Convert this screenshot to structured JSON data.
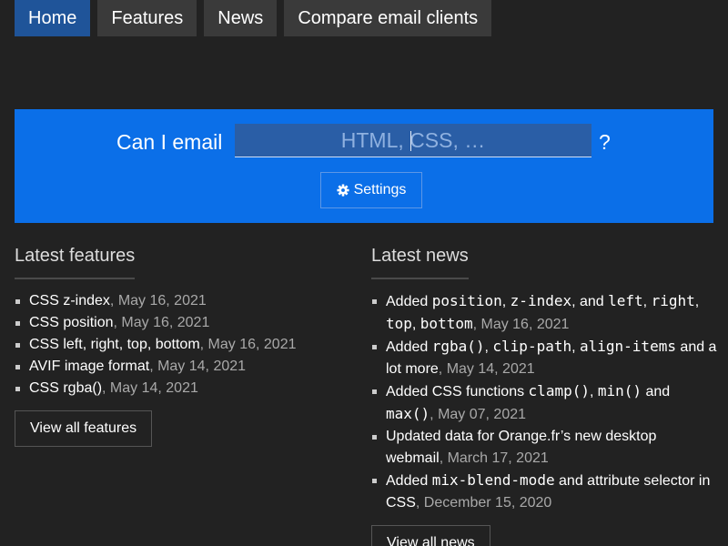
{
  "nav": {
    "items": [
      {
        "label": "Home",
        "active": true
      },
      {
        "label": "Features",
        "active": false
      },
      {
        "label": "News",
        "active": false
      },
      {
        "label": "Compare email clients",
        "active": false
      }
    ]
  },
  "hero": {
    "label": "Can I email",
    "search_placeholder": "HTML, CSS, …",
    "question_mark": "?",
    "settings_label": "Settings",
    "settings_icon": "gear-icon",
    "accent_color": "#0b6fe8"
  },
  "features": {
    "title": "Latest features",
    "items": [
      {
        "name": "CSS z-index",
        "date": "May 16, 2021"
      },
      {
        "name": "CSS position",
        "date": "May 16, 2021"
      },
      {
        "name": "CSS left, right, top, bottom",
        "date": "May 16, 2021"
      },
      {
        "name": "AVIF image format",
        "date": "May 14, 2021"
      },
      {
        "name": "CSS rgba()",
        "date": "May 14, 2021"
      }
    ],
    "view_all_label": "View all features"
  },
  "news": {
    "title": "Latest news",
    "items": [
      {
        "parts": [
          "Added ",
          "position",
          ", ",
          "z-index",
          ", and ",
          "left",
          ", ",
          "right",
          ", ",
          "top",
          ", ",
          "bottom"
        ],
        "date": "May 16, 2021"
      },
      {
        "parts": [
          "Added ",
          "rgba()",
          ", ",
          "clip-path",
          ", ",
          "align-items",
          " and a lot more"
        ],
        "date": "May 14, 2021"
      },
      {
        "parts": [
          "Added CSS functions ",
          "clamp()",
          ", ",
          "min()",
          " and ",
          "max()"
        ],
        "date": "May 07, 2021"
      },
      {
        "parts": [
          "Updated data for Orange.fr’s new desktop webmail"
        ],
        "date": "March 17, 2021"
      },
      {
        "parts": [
          "Added ",
          "mix-blend-mode",
          " and attribute selector in CSS"
        ],
        "date": "December 15, 2020"
      }
    ],
    "view_all_label": "View all news"
  }
}
